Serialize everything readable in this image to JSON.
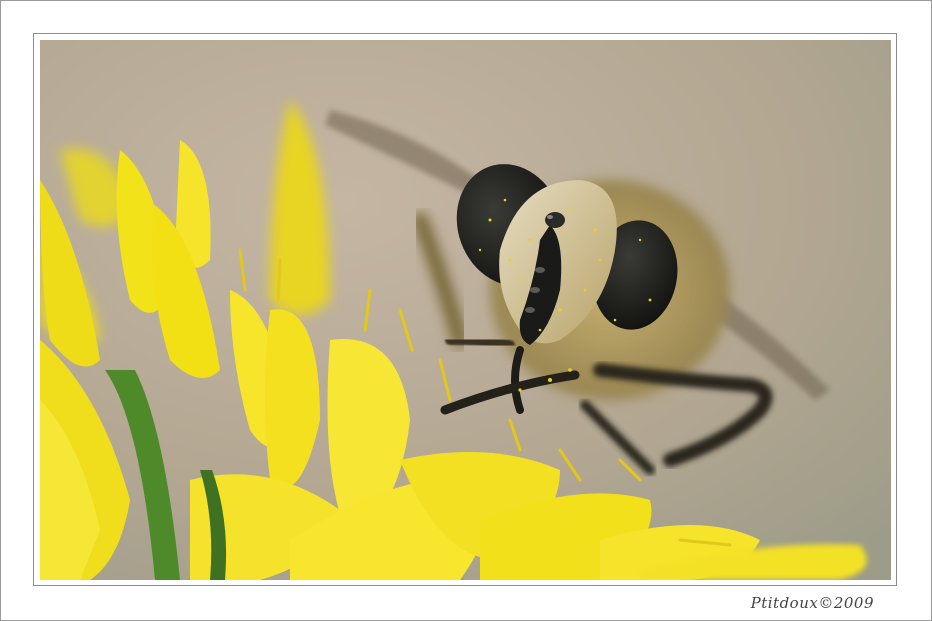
{
  "photo": {
    "subject": "hoverfly-on-yellow-flower",
    "colors": {
      "background_warm": "#b7a894",
      "background_cool": "#9a9a88",
      "petal_yellow": "#f2e21a",
      "petal_highlight": "#fbf36a",
      "eye_black": "#1c1c1a",
      "pollen": "#e8d21a",
      "stem_green": "#4f8a2a"
    }
  },
  "signature": {
    "text": "Ptitdoux©2009"
  }
}
